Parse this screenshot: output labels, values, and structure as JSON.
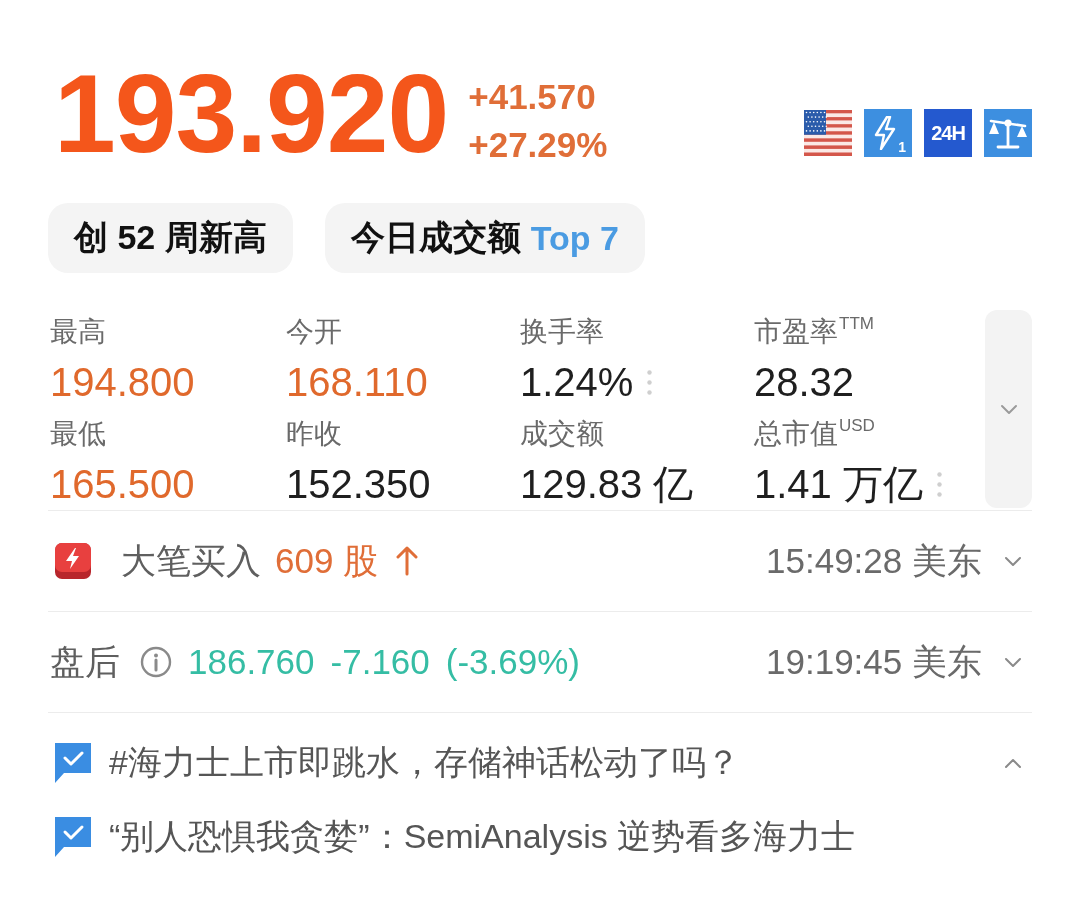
{
  "quote": {
    "price": "193.920",
    "change": "+41.570",
    "change_percent": "+27.29%",
    "up": true
  },
  "market_icons": [
    {
      "kind": "flag"
    },
    {
      "kind": "bolt",
      "label": "1"
    },
    {
      "kind": "text",
      "label": "24H"
    },
    {
      "kind": "scale"
    }
  ],
  "tags": [
    {
      "label": "创 52 周新高"
    },
    {
      "label": "今日成交额",
      "highlight": "Top 7"
    }
  ],
  "stats": {
    "expanded": false,
    "items": [
      {
        "label": "最高",
        "value": "194.800",
        "color": "#e0692c",
        "more": false
      },
      {
        "label": "今开",
        "value": "168.110",
        "color": "#e0692c",
        "more": false
      },
      {
        "label": "换手率",
        "value": "1.24%",
        "color": "#1f1f1f",
        "more": true
      },
      {
        "label": "市盈率$^{TTM}$",
        "value": "28.32",
        "color": "#1f1f1f",
        "more": false
      },
      {
        "label": "最低",
        "value": "165.500",
        "color": "#e0692c",
        "more": false
      },
      {
        "label": "昨收",
        "value": "152.350",
        "color": "#1f1f1f",
        "more": false
      },
      {
        "label": "成交额",
        "value": "129.83 亿",
        "color": "#1f1f1f",
        "more": false
      },
      {
        "label": "总市值$^{USD}$",
        "value": "1.41 万亿",
        "color": "#1f1f1f",
        "more": true
      }
    ]
  },
  "block_trade": {
    "label": "大笔买入",
    "amount": "609 股",
    "up": true,
    "time": "15:49:28 美东",
    "expanded": false
  },
  "after_hours": {
    "label": "盘后",
    "price": "186.760",
    "change": "-7.160",
    "change_percent": "(-3.69%)",
    "up": false,
    "time": "19:19:45 美东",
    "expanded": false
  },
  "topics": {
    "expanded": true,
    "items": [
      {
        "text": "#海力士上市即跳水，存储神话松动了吗？"
      },
      {
        "text": "“别人恐惧我贪婪”：SemiAnalysis 逆势看多海力士"
      }
    ]
  }
}
